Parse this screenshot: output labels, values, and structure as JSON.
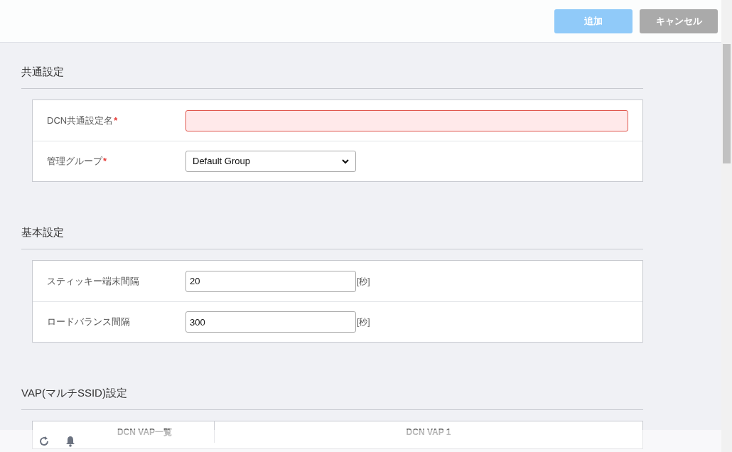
{
  "header": {
    "buttons": [
      {
        "label": "追加",
        "kind": "primary",
        "disabled": true
      },
      {
        "label": "キャンセル",
        "kind": "secondary",
        "disabled": false
      }
    ]
  },
  "sections": [
    {
      "title": "共通設定",
      "kind": "form",
      "rows": [
        {
          "label": "DCN共通設定名",
          "required_mark": "*",
          "kind": "text",
          "value": "",
          "invalid": true
        },
        {
          "label": "管理グループ",
          "required_mark": "*",
          "kind": "select",
          "value": "Default Group"
        }
      ]
    },
    {
      "title": "基本設定",
      "kind": "form",
      "rows": [
        {
          "label": "スティッキー端末間隔",
          "kind": "text",
          "value": "20",
          "unit": "[秒]",
          "invalid": false
        },
        {
          "label": "ロードバランス間隔",
          "kind": "text",
          "value": "300",
          "unit": "[秒]",
          "invalid": false
        }
      ]
    },
    {
      "title": "VAP(マルチSSID)設定",
      "kind": "table",
      "columns": [
        "DCN VAP一覧",
        "DCN VAP 1"
      ]
    }
  ]
}
